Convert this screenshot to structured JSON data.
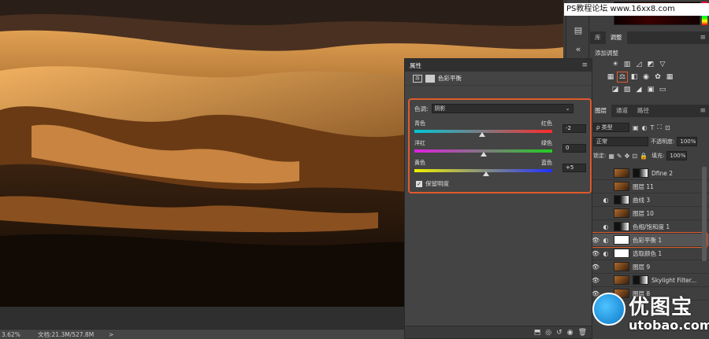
{
  "status": {
    "zoom": "3.62%",
    "doc": "文档:21.3M/527.8M",
    "arrow": ">"
  },
  "watermark": "PS教程论坛 www.16xx8.com",
  "dock": {
    "tabs_top": [
      {
        "label": "库"
      },
      {
        "label": "调整",
        "active": true
      }
    ],
    "adjustments_title": "添加调整",
    "layer_tabs": [
      {
        "label": "图层",
        "active": true
      },
      {
        "label": "通道"
      },
      {
        "label": "路径"
      }
    ],
    "filter_type": "ρ 类型",
    "blend_mode": "正常",
    "opacity_label": "不透明度:",
    "opacity_value": "100%",
    "lock_label": "锁定:",
    "fill_label": "填充:",
    "fill_value": "100%",
    "layers": [
      {
        "name": "Dfine 2",
        "kind": "pixel",
        "visible": false
      },
      {
        "name": "图层 11",
        "kind": "pixel",
        "visible": false
      },
      {
        "name": "曲线 3",
        "kind": "adjust",
        "visible": false
      },
      {
        "name": "图层 10",
        "kind": "pixel",
        "visible": false
      },
      {
        "name": "色相/饱和度 1",
        "kind": "adjust",
        "visible": false
      },
      {
        "name": "色彩平衡 1",
        "kind": "adjust",
        "visible": true,
        "selected": true
      },
      {
        "name": "选取颜色 1",
        "kind": "adjust",
        "visible": true
      },
      {
        "name": "图层 9",
        "kind": "pixel",
        "visible": true
      },
      {
        "name": "Skylight Filter...",
        "kind": "pixel",
        "visible": true
      },
      {
        "name": "图层 8",
        "kind": "pixel",
        "visible": true
      }
    ]
  },
  "properties": {
    "title": "属性",
    "adjustment_name": "色彩平衡",
    "tone_label": "色调:",
    "tone_value": "阴影",
    "sliders": [
      {
        "left": "青色",
        "right": "红色",
        "value": "-2",
        "position": 0.49,
        "gradient": [
          "#00c8d8",
          "#ff2a2a"
        ]
      },
      {
        "left": "洋红",
        "right": "绿色",
        "value": "0",
        "position": 0.5,
        "gradient": [
          "#e020e0",
          "#20d020"
        ]
      },
      {
        "left": "黄色",
        "right": "蓝色",
        "value": "+5",
        "position": 0.52,
        "gradient": [
          "#f0f000",
          "#2030ff"
        ]
      }
    ],
    "preserve_luminosity": "保留明度"
  },
  "logo": {
    "cn": "优图宝",
    "url": "utobao.com"
  }
}
